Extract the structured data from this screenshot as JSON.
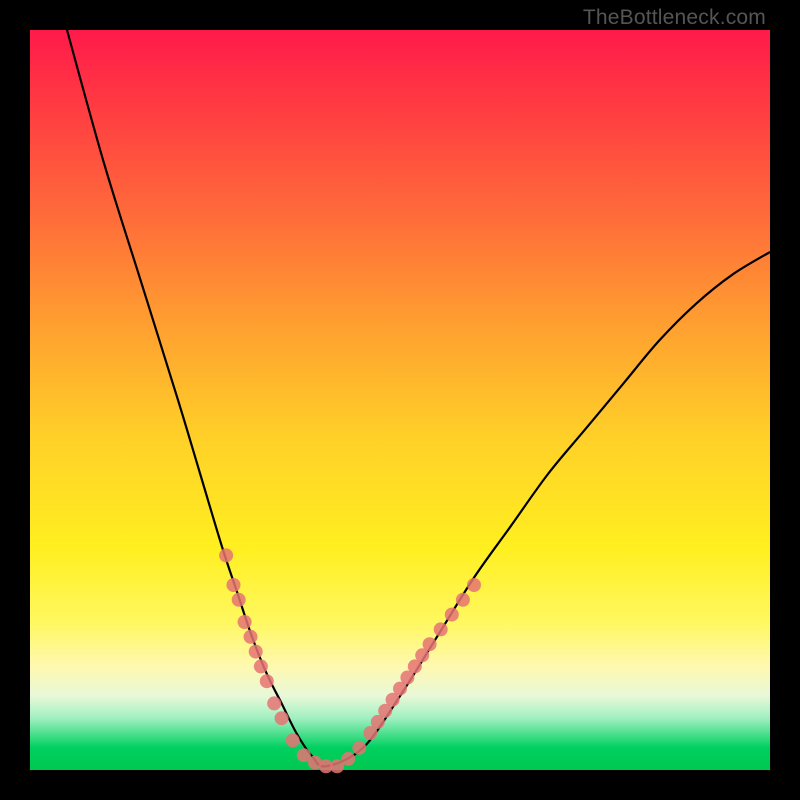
{
  "watermark": "TheBottleneck.com",
  "chart_data": {
    "type": "line",
    "title": "",
    "xlabel": "",
    "ylabel": "",
    "xlim": [
      0,
      100
    ],
    "ylim": [
      0,
      100
    ],
    "grid": false,
    "gradient_stops": [
      {
        "pos": 0,
        "color": "#ff1a4a"
      },
      {
        "pos": 10,
        "color": "#ff3a42"
      },
      {
        "pos": 25,
        "color": "#ff6b3a"
      },
      {
        "pos": 40,
        "color": "#ffa030"
      },
      {
        "pos": 55,
        "color": "#ffd028"
      },
      {
        "pos": 70,
        "color": "#ffef20"
      },
      {
        "pos": 80,
        "color": "#fff860"
      },
      {
        "pos": 86,
        "color": "#fff8b0"
      },
      {
        "pos": 90,
        "color": "#e8f8d8"
      },
      {
        "pos": 93,
        "color": "#a0f0c0"
      },
      {
        "pos": 95,
        "color": "#50e090"
      },
      {
        "pos": 97,
        "color": "#00d060"
      },
      {
        "pos": 100,
        "color": "#00c850"
      }
    ],
    "series": [
      {
        "name": "bottleneck_curve",
        "color": "#000000",
        "x": [
          5,
          10,
          15,
          20,
          23,
          26,
          28,
          30,
          32,
          34,
          36,
          38,
          40,
          45,
          50,
          55,
          60,
          65,
          70,
          75,
          80,
          85,
          90,
          95,
          100
        ],
        "y": [
          100,
          82,
          66,
          50,
          40,
          30,
          24,
          18,
          13,
          9,
          5,
          2,
          0.5,
          3,
          10,
          18,
          26,
          33,
          40,
          46,
          52,
          58,
          63,
          67,
          70
        ]
      }
    ],
    "markers": {
      "name": "highlight_dots",
      "color": "#e57373",
      "radius": 7,
      "points": [
        {
          "x": 26.5,
          "y": 29
        },
        {
          "x": 27.5,
          "y": 25
        },
        {
          "x": 28.2,
          "y": 23
        },
        {
          "x": 29.0,
          "y": 20
        },
        {
          "x": 29.8,
          "y": 18
        },
        {
          "x": 30.5,
          "y": 16
        },
        {
          "x": 31.2,
          "y": 14
        },
        {
          "x": 32.0,
          "y": 12
        },
        {
          "x": 33.0,
          "y": 9
        },
        {
          "x": 34.0,
          "y": 7
        },
        {
          "x": 35.5,
          "y": 4
        },
        {
          "x": 37.0,
          "y": 2
        },
        {
          "x": 38.5,
          "y": 1
        },
        {
          "x": 40.0,
          "y": 0.5
        },
        {
          "x": 41.5,
          "y": 0.5
        },
        {
          "x": 43.0,
          "y": 1.5
        },
        {
          "x": 44.5,
          "y": 3
        },
        {
          "x": 46.0,
          "y": 5
        },
        {
          "x": 47.0,
          "y": 6.5
        },
        {
          "x": 48.0,
          "y": 8
        },
        {
          "x": 49.0,
          "y": 9.5
        },
        {
          "x": 50.0,
          "y": 11
        },
        {
          "x": 51.0,
          "y": 12.5
        },
        {
          "x": 52.0,
          "y": 14
        },
        {
          "x": 53.0,
          "y": 15.5
        },
        {
          "x": 54.0,
          "y": 17
        },
        {
          "x": 55.5,
          "y": 19
        },
        {
          "x": 57.0,
          "y": 21
        },
        {
          "x": 58.5,
          "y": 23
        },
        {
          "x": 60.0,
          "y": 25
        }
      ]
    }
  }
}
